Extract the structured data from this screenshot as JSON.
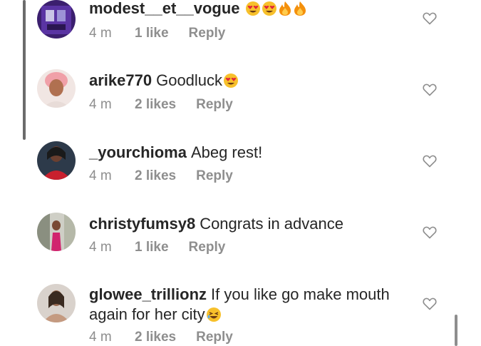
{
  "comments": [
    {
      "username": "modest__et__vogue",
      "text": "",
      "emojis": [
        "heart-eyes",
        "heart-eyes",
        "fire",
        "fire"
      ],
      "time": "4 m",
      "likes": "1 like",
      "reply": "Reply"
    },
    {
      "username": "arike770",
      "text": "Goodluck",
      "emojis": [
        "heart-eyes"
      ],
      "time": "4 m",
      "likes": "2 likes",
      "reply": "Reply"
    },
    {
      "username": "_yourchioma",
      "text": "Abeg rest!",
      "emojis": [],
      "time": "4 m",
      "likes": "2 likes",
      "reply": "Reply"
    },
    {
      "username": "christyfumsy8",
      "text": "Congrats in advance",
      "emojis": [],
      "time": "4 m",
      "likes": "1 like",
      "reply": "Reply"
    },
    {
      "username": "glowee_trillionz",
      "text": "If you like go make mouth again for her city",
      "emojis": [
        "laughing"
      ],
      "time": "4 m",
      "likes": "2 likes",
      "reply": "Reply"
    }
  ],
  "colors": {
    "text": "#262626",
    "secondary": "#8e8e8e",
    "emoji_yellow": "#f7c02b",
    "emoji_heart": "#e0243a",
    "fire": "#f4900c"
  },
  "icons": {
    "like": "heart-outline-icon"
  }
}
